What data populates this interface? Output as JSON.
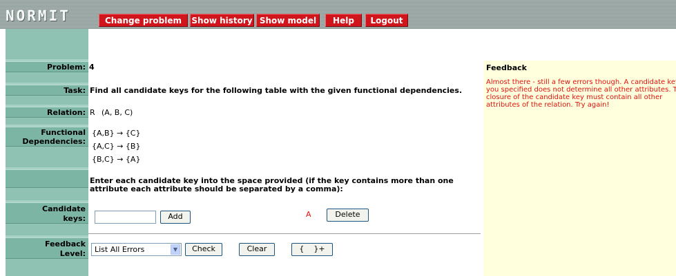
{
  "header": {
    "logo": "NORMIT",
    "nav": [
      "Change problem",
      "Show history",
      "Show model",
      "Help",
      "Logout"
    ]
  },
  "labels": {
    "problem": "Problem:",
    "task": "Task:",
    "relation": "Relation:",
    "fd_line1": "Functional",
    "fd_line2": "Dependencies:",
    "ck_line1": "Candidate",
    "ck_line2": "keys:",
    "fl_line1": "Feedback",
    "fl_line2": "Level:"
  },
  "problem_number": "4",
  "task_text": "Find all candidate keys for the following table with the given functional dependencies.",
  "relation": {
    "name": "R",
    "attributes": "(A, B, C)"
  },
  "dependencies": [
    "{A,B} → {C}",
    "{A,C} → {B}",
    "{B,C} → {A}"
  ],
  "instruction_line1": "Enter each candidate key into the space provided (if the key contains more than one",
  "instruction_line2": "attribute each attribute should be separated by a comma):",
  "candidate_input": {
    "value": ""
  },
  "add_button": "Add",
  "entered_key": "A",
  "delete_button": "Delete",
  "feedback_level": {
    "selected": "List All Errors"
  },
  "check_button": "Check",
  "clear_button": "Clear",
  "braces_button": "{    }+",
  "feedback": {
    "title": "Feedback",
    "message": "Almost there - still a few errors though. A candidate key you specified does not determine all other attributes. The closure of the candidate key must contain all other attributes of the relation. Try again!"
  },
  "colors": {
    "nav_button": "#d0161c",
    "left_column": "#8fc2b3",
    "feedback_bg": "#ffffdd",
    "feedback_text": "#e01010"
  }
}
